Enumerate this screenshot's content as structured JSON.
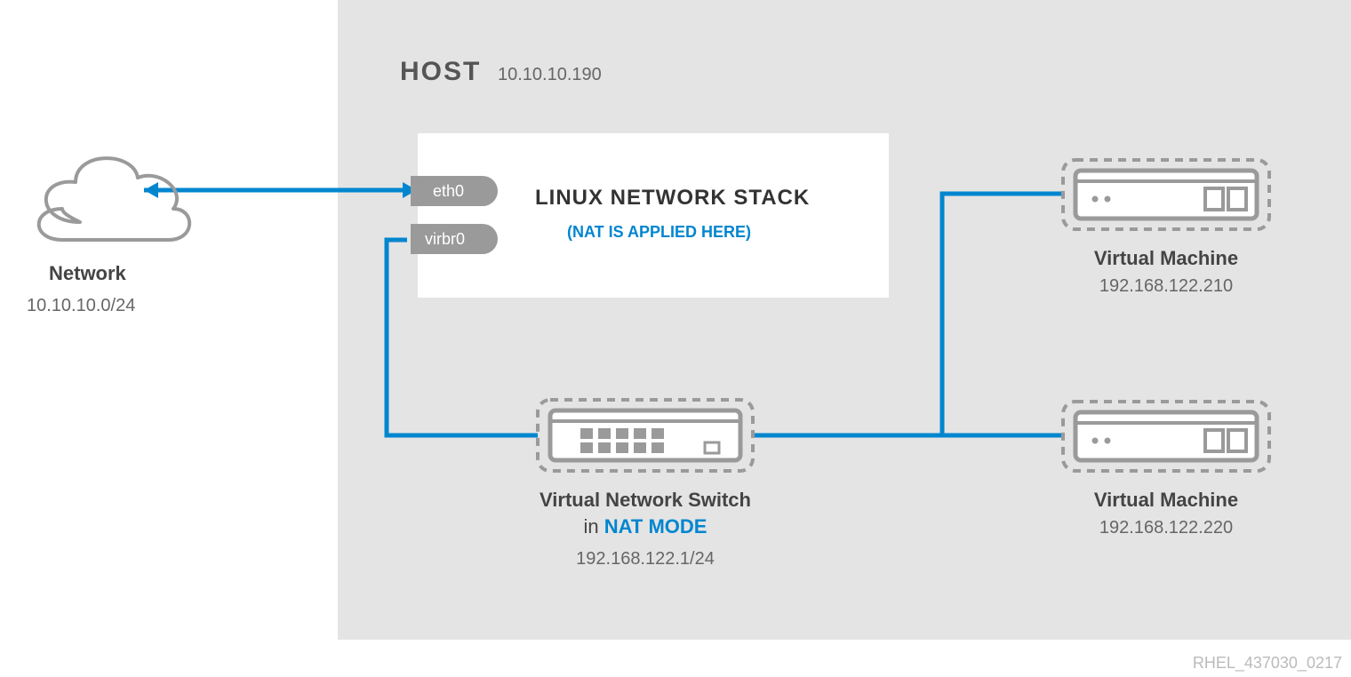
{
  "colors": {
    "accent": "#0086cf",
    "grey": "#999999",
    "panel": "#e4e4e4",
    "dash": "#9a9a9a"
  },
  "network": {
    "title": "Network",
    "subnet": "10.10.10.0/24"
  },
  "host": {
    "title": "HOST",
    "ip": "10.10.10.190",
    "interfaces": {
      "eth": "eth0",
      "virbr": "virbr0"
    },
    "stack": {
      "title": "LINUX NETWORK STACK",
      "note": "(NAT IS APPLIED HERE)"
    }
  },
  "vswitch": {
    "title": "Virtual Network Switch",
    "mode_prefix": "in ",
    "mode": "NAT MODE",
    "ip": "192.168.122.1/24"
  },
  "vms": [
    {
      "title": "Virtual Machine",
      "ip": "192.168.122.210"
    },
    {
      "title": "Virtual Machine",
      "ip": "192.168.122.220"
    }
  ],
  "marker": "RHEL_437030_0217"
}
